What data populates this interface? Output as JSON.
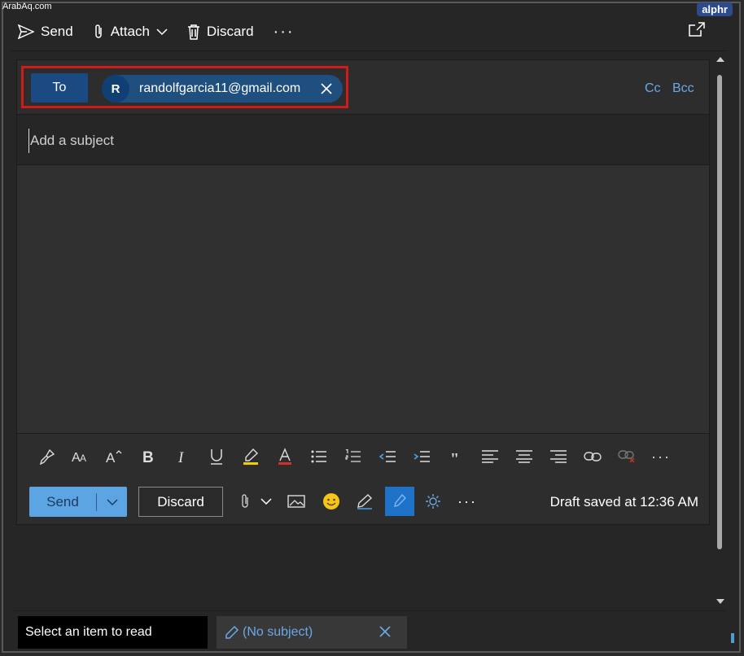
{
  "watermarks": {
    "left": "ArabAq.com",
    "right": "alphr"
  },
  "toolbar": {
    "send_label": "Send",
    "attach_label": "Attach",
    "discard_label": "Discard",
    "more_label": "···"
  },
  "recipients": {
    "to_label": "To",
    "chips": [
      {
        "initial": "R",
        "email": "randolfgarcia11@gmail.com"
      }
    ],
    "cc_label": "Cc",
    "bcc_label": "Bcc"
  },
  "subject": {
    "placeholder": "Add a subject",
    "value": ""
  },
  "format_toolbar": {
    "icons": [
      "format-painter-icon",
      "font-size-icon",
      "increase-font-icon",
      "bold-icon",
      "italic-icon",
      "underline-icon",
      "highlight-icon",
      "font-color-icon",
      "bullets-icon",
      "numbering-icon",
      "decrease-indent-icon",
      "increase-indent-icon",
      "quote-icon",
      "align-left-icon",
      "align-center-icon",
      "align-right-icon",
      "link-icon",
      "unlink-icon",
      "more-icon"
    ]
  },
  "actions": {
    "send_label": "Send",
    "discard_label": "Discard",
    "more_label": "···",
    "draft_status": "Draft saved at 12:36 AM"
  },
  "bottom_tabs": {
    "reading_label": "Select an item to read",
    "draft_label": "(No subject)"
  },
  "colors": {
    "accent": "#5da5e2",
    "link": "#6aa8e8",
    "to_button": "#1b4a82",
    "highlight": "#d01b1b"
  }
}
